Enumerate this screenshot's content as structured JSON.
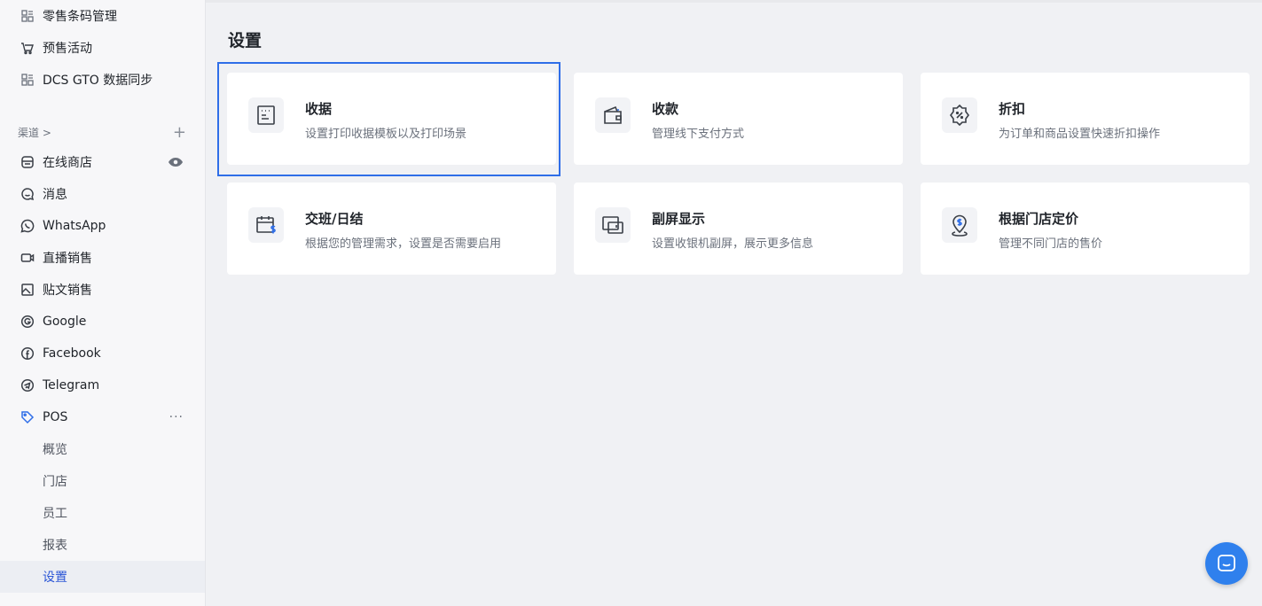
{
  "sidebar": {
    "top_items": [
      {
        "label": "零售条码管理",
        "icon": "barcode-grid-icon"
      },
      {
        "label": "预售活动",
        "icon": "presale-cart-icon"
      },
      {
        "label": "DCS GTO 数据同步",
        "icon": "sync-grid-icon"
      }
    ],
    "channels_label": "渠道 >",
    "channels_add": "+",
    "channels": [
      {
        "label": "在线商店",
        "icon": "store-icon"
      },
      {
        "label": "消息",
        "icon": "chat-icon"
      },
      {
        "label": "WhatsApp",
        "icon": "whatsapp-icon"
      },
      {
        "label": "直播销售",
        "icon": "live-video-icon"
      },
      {
        "label": "贴文销售",
        "icon": "image-post-icon"
      },
      {
        "label": "Google",
        "icon": "google-icon"
      },
      {
        "label": "Facebook",
        "icon": "facebook-icon"
      },
      {
        "label": "Telegram",
        "icon": "telegram-icon"
      },
      {
        "label": "POS",
        "icon": "pos-tag-icon"
      }
    ],
    "pos_more": "···",
    "pos_sub": [
      {
        "label": "概览"
      },
      {
        "label": "门店"
      },
      {
        "label": "员工"
      },
      {
        "label": "报表"
      },
      {
        "label": "设置",
        "active": true
      }
    ]
  },
  "main": {
    "title": "设置",
    "cards": [
      {
        "title": "收据",
        "desc": "设置打印收据模板以及打印场景",
        "icon": "receipt-icon"
      },
      {
        "title": "收款",
        "desc": "管理线下支付方式",
        "icon": "wallet-icon"
      },
      {
        "title": "折扣",
        "desc": "为订单和商品设置快速折扣操作",
        "icon": "discount-badge-icon"
      },
      {
        "title": "交班/日结",
        "desc": "根据您的管理需求，设置是否需要启用",
        "icon": "shift-calendar-icon"
      },
      {
        "title": "副屏显示",
        "desc": "设置收银机副屏，展示更多信息",
        "icon": "second-screen-icon"
      },
      {
        "title": "根据门店定价",
        "desc": "管理不同门店的售价",
        "icon": "location-price-icon"
      }
    ]
  },
  "colors": {
    "accent": "#2f6ee8",
    "chat_button": "#2f80ed",
    "active_text": "#2a55d6"
  }
}
